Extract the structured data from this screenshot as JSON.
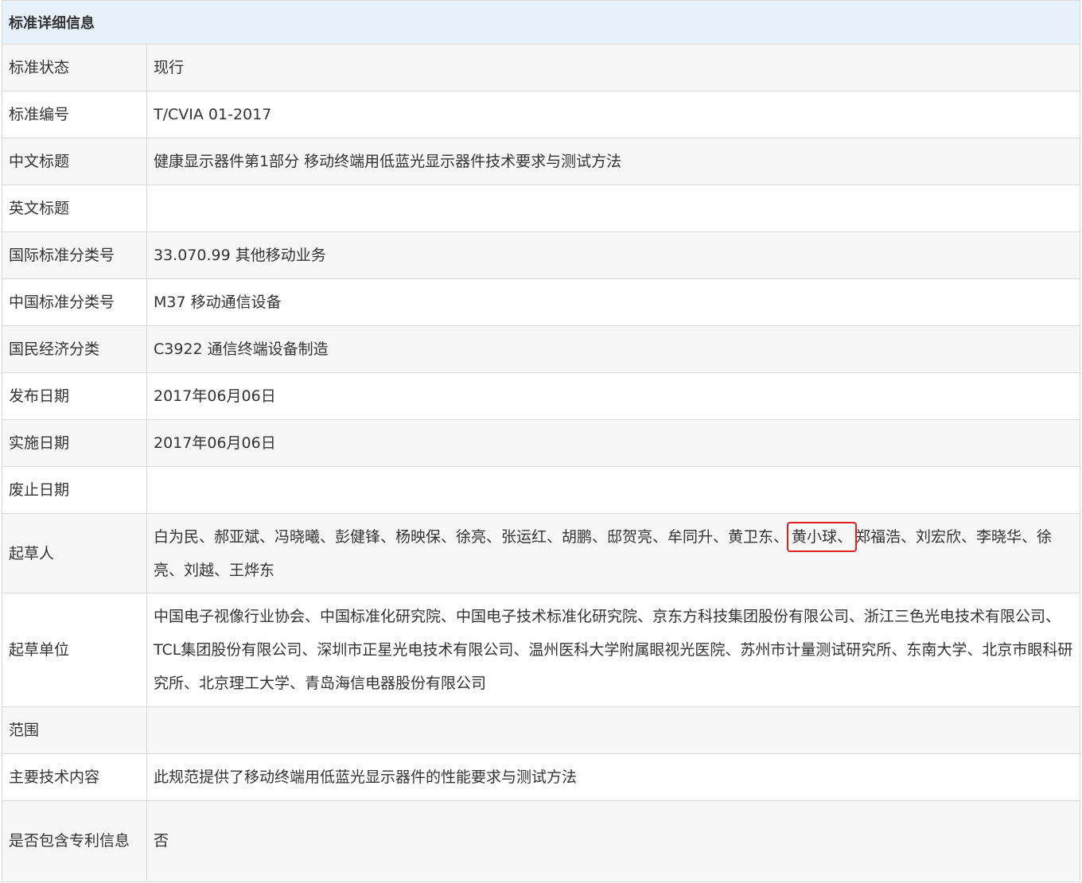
{
  "header": {
    "title": "标准详细信息"
  },
  "rows": [
    {
      "label": "标准状态",
      "value": "现行"
    },
    {
      "label": "标准编号",
      "value": "T/CVIA 01-2017"
    },
    {
      "label": "中文标题",
      "value": "健康显示器件第1部分 移动终端用低蓝光显示器件技术要求与测试方法"
    },
    {
      "label": "英文标题",
      "value": ""
    },
    {
      "label": "国际标准分类号",
      "value": "33.070.99 其他移动业务"
    },
    {
      "label": "中国标准分类号",
      "value": "M37 移动通信设备"
    },
    {
      "label": "国民经济分类",
      "value": "C3922 通信终端设备制造"
    },
    {
      "label": "发布日期",
      "value": "2017年06月06日"
    },
    {
      "label": "实施日期",
      "value": "2017年06月06日"
    },
    {
      "label": "废止日期",
      "value": ""
    },
    {
      "label": "起草人",
      "value_before": "白为民、郝亚斌、冯晓曦、彭健锋、杨映保、徐亮、张运红、胡鹏、邸贺亮、牟同升、黄卫东、",
      "value_highlight": "黄小球、",
      "value_after": "郑福浩、刘宏欣、李晓华、徐亮、刘越、王烨东"
    },
    {
      "label": "起草单位",
      "value": "中国电子视像行业协会、中国标准化研究院、中国电子技术标准化研究院、京东方科技集团股份有限公司、浙江三色光电技术有限公司、TCL集团股份有限公司、深圳市正星光电技术有限公司、温州医科大学附属眼视光医院、苏州市计量测试研究所、东南大学、北京市眼科研究所、北京理工大学、青岛海信电器股份有限公司"
    },
    {
      "label": "范围",
      "value": ""
    },
    {
      "label": "主要技术内容",
      "value": "此规范提供了移动终端用低蓝光显示器件的性能要求与测试方法"
    },
    {
      "label": "是否包含专利信息",
      "value": "否"
    }
  ],
  "colors": {
    "header_bg": "#e6f1fc",
    "alt_row_bg": "#f7f7f7",
    "border": "#d9d9d9",
    "highlight_box": "#e02020"
  }
}
